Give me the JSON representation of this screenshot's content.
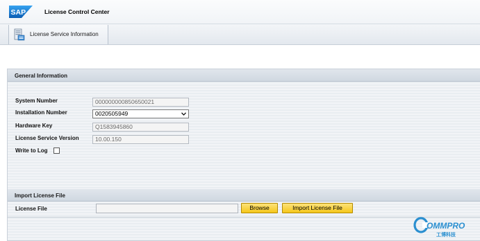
{
  "header": {
    "logo_text": "SAP",
    "title": "License Control Center"
  },
  "toolbar": {
    "tab_label": "License Service Information"
  },
  "general": {
    "section_title": "General Information",
    "system_number_label": "System Number",
    "system_number_value": "000000000850650021",
    "installation_number_label": "Installation Number",
    "installation_number_value": "0020505949",
    "hardware_key_label": "Hardware Key",
    "hardware_key_value": "Q1583945860",
    "license_service_version_label": "License Service Version",
    "license_service_version_value": "10.00.150",
    "write_to_log_label": "Write to Log",
    "write_to_log_checked": false
  },
  "import": {
    "section_title": "Import License File",
    "license_file_label": "License File",
    "browse_label": "Browse",
    "import_button_label": "Import License File"
  },
  "watermark": {
    "brand": "COMMPRO",
    "subtext": "工博科技"
  },
  "colors": {
    "sap_blue": "#1a73c9",
    "button_yellow": "#f5c71a",
    "watermark_blue": "#2a8fd0"
  }
}
